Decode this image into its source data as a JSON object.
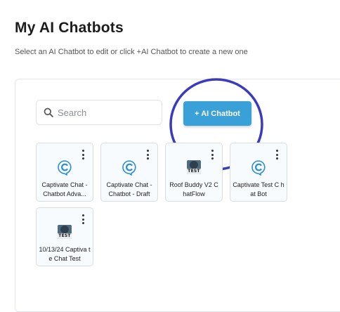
{
  "header": {
    "title": "My AI Chatbots",
    "subtitle": "Select an AI Chatbot to edit or click +AI Chatbot to create a new one"
  },
  "search": {
    "placeholder": "Search",
    "value": ""
  },
  "add_button_label": "+ AI Chatbot",
  "colors": {
    "accent": "#3aa0d8",
    "annotation": "#3b3bbd",
    "chat_icon": "#2a8fd0"
  },
  "chatbots": [
    {
      "label": "Captivate Chat - Chatbot Adva...",
      "icon": "captivate-chat-icon"
    },
    {
      "label": "Captivate Chat - Chatbot - Draft",
      "icon": "captivate-chat-icon"
    },
    {
      "label": "Roof Buddy V2 ChatFlow",
      "icon": "test-avatar-icon",
      "icon_text": "TEST"
    },
    {
      "label": "Captivate Test C hat Bot",
      "icon": "captivate-chat-icon"
    },
    {
      "label": "10/13/24 Captiva te Chat Test",
      "icon": "test-avatar-icon",
      "icon_text": "TEST"
    }
  ]
}
